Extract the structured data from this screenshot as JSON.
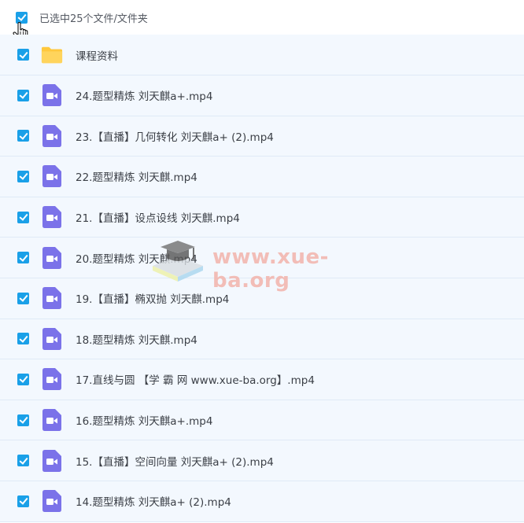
{
  "header": {
    "selection_text": "已选中25个文件/文件夹"
  },
  "files": [
    {
      "name": "课程资料",
      "type": "folder"
    },
    {
      "name": "24.题型精炼 刘天麒a+.mp4",
      "type": "video"
    },
    {
      "name": "23.【直播】几何转化 刘天麒a+ (2).mp4",
      "type": "video"
    },
    {
      "name": "22.题型精炼 刘天麒.mp4",
      "type": "video"
    },
    {
      "name": "21.【直播】设点设线 刘天麒.mp4",
      "type": "video"
    },
    {
      "name": "20.题型精炼 刘天麒.mp4",
      "type": "video"
    },
    {
      "name": "19.【直播】椭双抛 刘天麒.mp4",
      "type": "video"
    },
    {
      "name": "18.题型精炼 刘天麒.mp4",
      "type": "video"
    },
    {
      "name": "17.直线与圆 【学 霸 网 www.xue-ba.org】.mp4",
      "type": "video"
    },
    {
      "name": "16.题型精炼 刘天麒a+.mp4",
      "type": "video"
    },
    {
      "name": "15.【直播】空间向量 刘天麒a+ (2).mp4",
      "type": "video"
    },
    {
      "name": "14.题型精炼 刘天麒a+ (2).mp4",
      "type": "video"
    }
  ],
  "watermark": {
    "text": "www.xue-ba.org"
  },
  "colors": {
    "checkbox": "#1aa0e8",
    "video_icon": "#7b72e9",
    "folder": "#ffc83d",
    "row_bg": "#f3f8fe"
  }
}
